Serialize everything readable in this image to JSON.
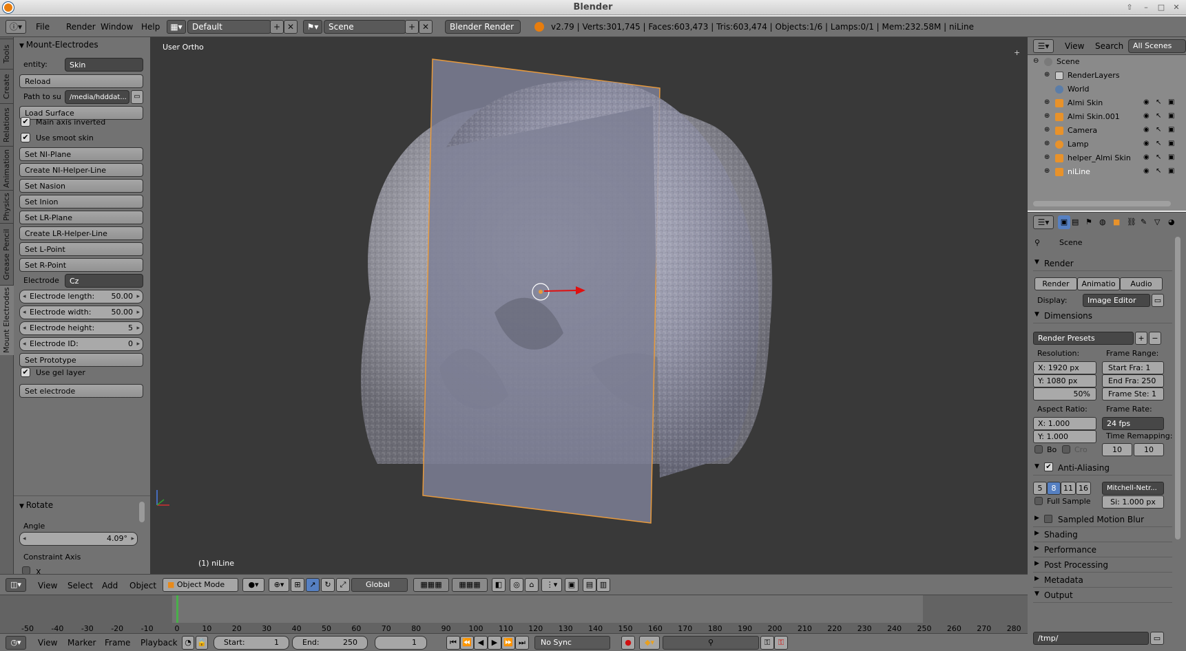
{
  "window": {
    "title": "Blender"
  },
  "info": {
    "menus": [
      "File",
      "Render",
      "Window",
      "Help"
    ],
    "layout": "Default",
    "scene": "Scene",
    "engine": "Blender Render",
    "stats": "v2.79 | Verts:301,745 | Faces:603,473 | Tris:603,474 | Objects:1/6 | Lamps:0/1 | Mem:232.58M | niLine"
  },
  "tabs": [
    "Tools",
    "Create",
    "Relations",
    "Animation",
    "Physics",
    "Grease Pencil",
    "Mount Electrodes"
  ],
  "panel": {
    "title": "Mount-Electrodes",
    "entity_label": "entity:",
    "entity_value": "Skin",
    "reload": "Reload",
    "path_label": "Path to su",
    "path_value": "/media/hdddat...",
    "load_surface": "Load Surface",
    "main_axis": "Main axis inverted",
    "smoot_skin": "Use smoot skin",
    "set_ni_plane": "Set NI-Plane",
    "create_ni_helper": "Create NI-Helper-Line",
    "set_nasion": "Set Nasion",
    "set_inion": "Set Inion",
    "set_lr_plane": "Set LR-Plane",
    "create_lr_helper": "Create LR-Helper-Line",
    "set_l_point": "Set L-Point",
    "set_r_point": "Set R-Point",
    "electrode_label": "Electrode",
    "electrode_value": "Cz",
    "len_label": "Electrode length:",
    "len_value": "50.00",
    "width_label": "Electrode width:",
    "width_value": "50.00",
    "height_label": "Electrode height:",
    "height_value": "5",
    "id_label": "Electrode ID:",
    "id_value": "0",
    "set_prototype": "Set Prototype",
    "gel_layer": "Use gel layer",
    "set_electrode": "Set electrode"
  },
  "redo": {
    "title": "Rotate",
    "angle_label": "Angle",
    "angle_value": "4.09°",
    "constraint_label": "Constraint Axis",
    "axis_x": "X"
  },
  "viewport": {
    "view_label": "User Ortho",
    "object_label": "(1) niLine"
  },
  "viewheader": {
    "menus": [
      "View",
      "Select",
      "Add",
      "Object"
    ],
    "mode": "Object Mode",
    "orientation": "Global"
  },
  "outliner": {
    "menus": [
      "View",
      "Search"
    ],
    "filter": "All Scenes",
    "items": [
      "Scene",
      "RenderLayers",
      "World",
      "Almi Skin",
      "Almi Skin.001",
      "Camera",
      "Lamp",
      "helper_Almi Skin",
      "niLine"
    ]
  },
  "properties": {
    "context": "Scene",
    "render_section": "Render",
    "render_btn": "Render",
    "animation_btn": "Animatio",
    "audio_btn": "Audio",
    "display_label": "Display:",
    "display_value": "Image Editor",
    "dimensions": "Dimensions",
    "presets": "Render Presets",
    "resolution_label": "Resolution:",
    "res_x": "X:   1920 px",
    "res_y": "Y:   1080 px",
    "res_pct": "50%",
    "frame_range_label": "Frame Range:",
    "start": "Start Fra:   1",
    "end": "End Fra: 250",
    "step": "Frame Ste: 1",
    "aspect_label": "Aspect Ratio:",
    "asp_x": "X:      1.000",
    "asp_y": "Y:      1.000",
    "frame_rate_label": "Frame Rate:",
    "fps": "24 fps",
    "remap_label": "Time Remapping:",
    "remap_a": "10",
    "remap_b": "10",
    "bo": "Bo",
    "cro": "Cro",
    "aa": "Anti-Aliasing",
    "aa_samples": [
      "5",
      "8",
      "11",
      "16"
    ],
    "filter": "Mitchell-Netr...",
    "full_sample": "Full Sample",
    "size": "Si: 1.000 px",
    "motion_blur": "Sampled Motion Blur",
    "shading": "Shading",
    "performance": "Performance",
    "post": "Post Processing",
    "metadata": "Metadata",
    "output": "Output",
    "output_path": "/tmp/"
  },
  "timeline": {
    "ticks": [
      "-50",
      "-40",
      "-30",
      "-20",
      "-10",
      "0",
      "10",
      "20",
      "30",
      "40",
      "50",
      "60",
      "70",
      "80",
      "90",
      "100",
      "110",
      "120",
      "130",
      "140",
      "150",
      "160",
      "170",
      "180",
      "190",
      "200",
      "210",
      "220",
      "230",
      "240",
      "250",
      "260",
      "270",
      "280"
    ],
    "menus": [
      "View",
      "Marker",
      "Frame",
      "Playback"
    ],
    "start": "Start:",
    "start_value": "1",
    "end": "End:",
    "end_value": "250",
    "current": "1",
    "sync": "No Sync"
  }
}
